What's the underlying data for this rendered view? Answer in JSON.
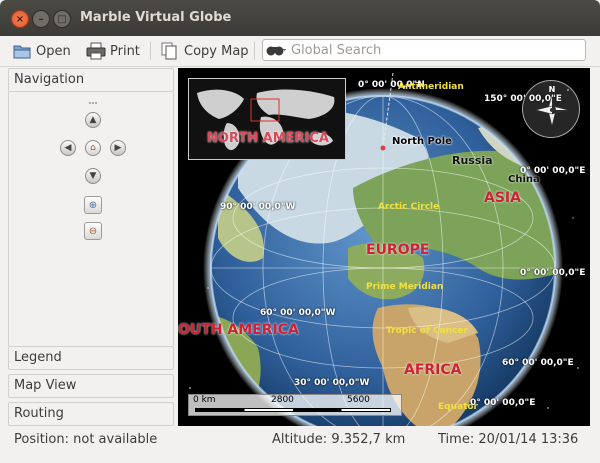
{
  "window": {
    "title": "Marble Virtual Globe",
    "close_glyph": "×",
    "min_glyph": "–",
    "max_glyph": "□"
  },
  "toolbar": {
    "open_label": "Open",
    "print_label": "Print",
    "copy_map_label": "Copy Map",
    "search_placeholder": "Global Search"
  },
  "sidebar": {
    "navigation_label": "Navigation",
    "legend_label": "Legend",
    "map_view_label": "Map View",
    "routing_label": "Routing"
  },
  "map": {
    "labels": {
      "north_pole": "North Pole",
      "russia": "Russia",
      "china": "China",
      "asia": "ASIA",
      "europe": "EUROPE",
      "africa": "AFRICA",
      "south_america": "OUTH AMERICA",
      "north_america_overview": "NORTH AMERICA",
      "arctic_circle": "Arctic Circle",
      "prime_meridian": "Prime Meridian",
      "tropic_of_cancer": "Tropic of Cancer",
      "equator": "Equator",
      "antimeridian": "Antimeridian",
      "coord_top": "0° 00' 00,0\"N",
      "coord_top_right": "150° 00' 00,0\"E",
      "coord_left": "90° 00' 00,0\"W",
      "coord_right_1": "0° 00' 00,0\"E",
      "coord_right_2": "0° 00' 00,0\"E",
      "coord_sw": "60° 00' 00,0\"W",
      "coord_right_3": "60° 00' 00,0\"E",
      "coord_right_4": "0° 00' 00,0\"E",
      "coord_bottom": "30° 00' 00,0\"W"
    },
    "scale": {
      "label_0": "0 km",
      "label_1": "2800",
      "label_2": "5600"
    }
  },
  "status": {
    "position": "Position: not available",
    "altitude": "Altitude:  9.352,7 km",
    "time": "Time: 20/01/14 13:36"
  }
}
